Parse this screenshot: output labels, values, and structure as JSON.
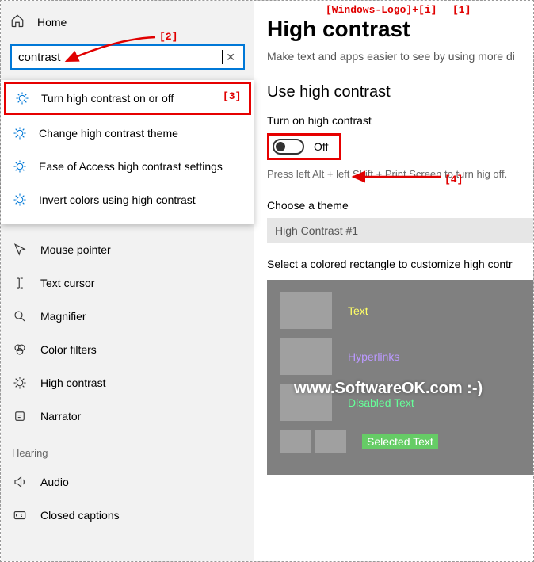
{
  "annotations": {
    "a1": "[Windows-Logo]+[i]",
    "a1_num": "[1]",
    "a2": "[2]",
    "a3": "[3]",
    "a4": "[4]"
  },
  "home_label": "Home",
  "search": {
    "value": "contrast",
    "clear": "✕"
  },
  "dropdown": [
    "Turn high contrast on or off",
    "Change high contrast theme",
    "Ease of Access high contrast settings",
    "Invert colors using high contrast"
  ],
  "sidebar": {
    "items": [
      "Mouse pointer",
      "Text cursor",
      "Magnifier",
      "Color filters",
      "High contrast",
      "Narrator"
    ],
    "section": "Hearing",
    "hearing_items": [
      "Audio",
      "Closed captions"
    ]
  },
  "main": {
    "title": "High contrast",
    "subtitle": "Make text and apps easier to see by using more di",
    "use_title": "Use high contrast",
    "toggle_label": "Turn on high contrast",
    "toggle_state": "Off",
    "hint": "Press left Alt + left Shift + Print Screen to turn hig off.",
    "choose_label": "Choose a theme",
    "theme_selected": "High Contrast #1",
    "custom_label": "Select a colored rectangle to customize high contr",
    "swatches": {
      "text": "Text",
      "hyperlinks": "Hyperlinks",
      "disabled": "Disabled Text",
      "selected": "Selected Text"
    }
  },
  "watermark": "www.SoftwareOK.com :-)"
}
